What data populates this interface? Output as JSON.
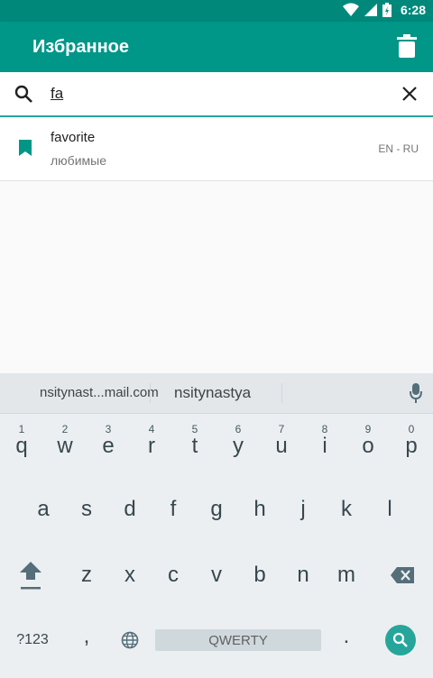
{
  "status_bar": {
    "time": "6:28"
  },
  "app_bar": {
    "title": "Избранное"
  },
  "search": {
    "value": "fa",
    "placeholder": ""
  },
  "favorites": [
    {
      "word": "favorite",
      "translation": "любимые",
      "lang": "EN - RU"
    }
  ],
  "keyboard": {
    "suggestions": [
      "nsitynast...mail.com",
      "nsitynastya"
    ],
    "row1": [
      {
        "label": "q",
        "hint": "1"
      },
      {
        "label": "w",
        "hint": "2"
      },
      {
        "label": "e",
        "hint": "3"
      },
      {
        "label": "r",
        "hint": "4"
      },
      {
        "label": "t",
        "hint": "5"
      },
      {
        "label": "y",
        "hint": "6"
      },
      {
        "label": "u",
        "hint": "7"
      },
      {
        "label": "i",
        "hint": "8"
      },
      {
        "label": "o",
        "hint": "9"
      },
      {
        "label": "p",
        "hint": "0"
      }
    ],
    "row2": [
      "a",
      "s",
      "d",
      "f",
      "g",
      "h",
      "j",
      "k",
      "l"
    ],
    "row3": [
      "z",
      "x",
      "c",
      "v",
      "b",
      "n",
      "m"
    ],
    "symbols_label": "?123",
    "comma_label": ",",
    "space_label": "QWERTY",
    "period_label": "."
  },
  "colors": {
    "primary": "#009688",
    "primary_dark": "#00897b",
    "accent": "#26a69a"
  }
}
